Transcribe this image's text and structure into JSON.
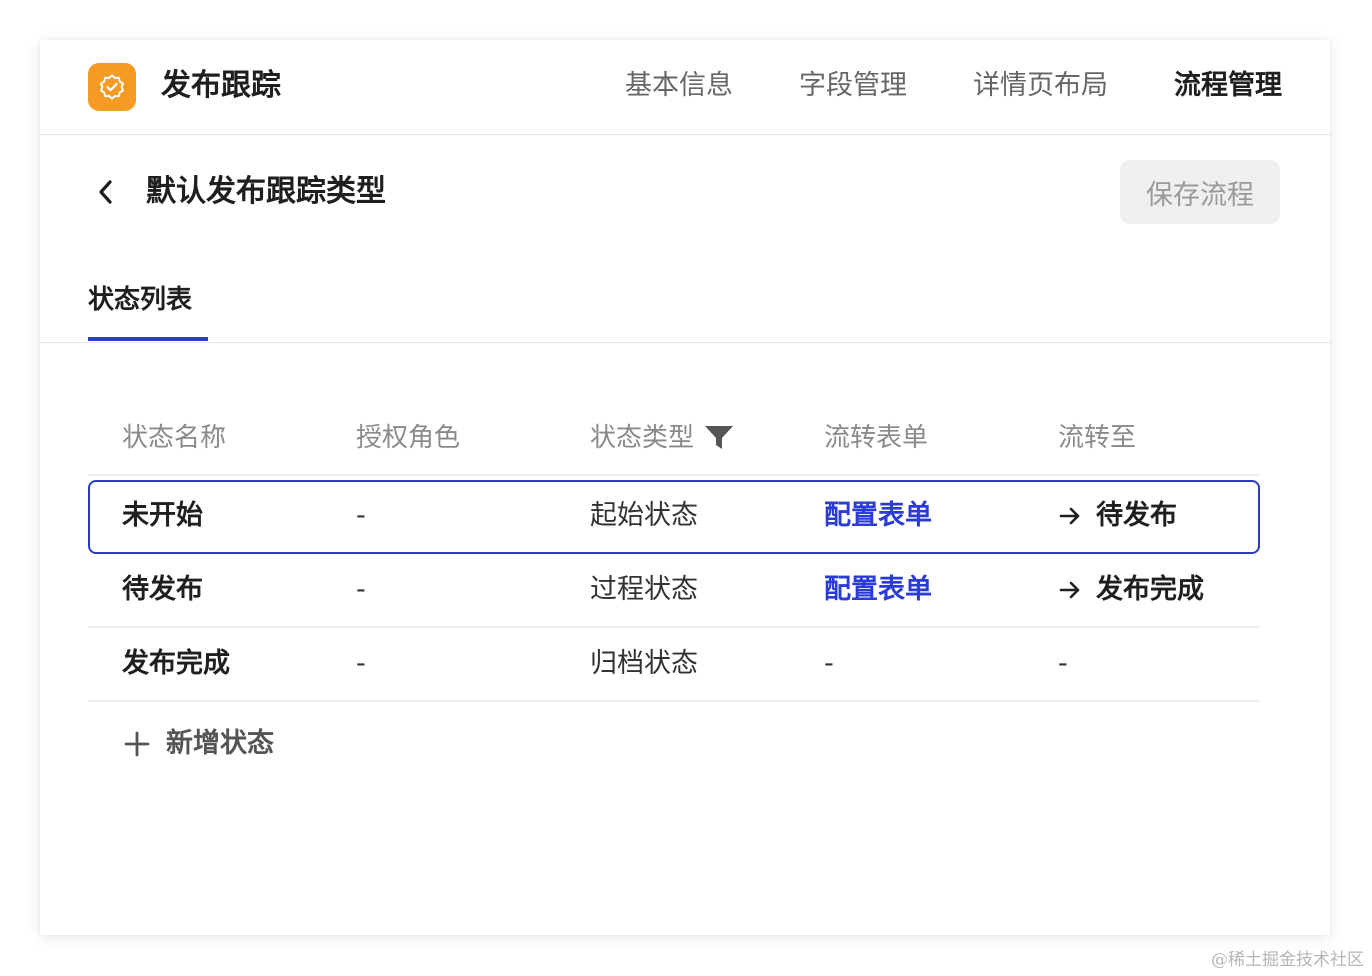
{
  "app": {
    "title": "发布跟踪",
    "logo_icon": "badge-check-icon",
    "logo_color": "#f59a23"
  },
  "top_nav": {
    "items": [
      {
        "label": "基本信息",
        "active": false
      },
      {
        "label": "字段管理",
        "active": false
      },
      {
        "label": "详情页布局",
        "active": false
      },
      {
        "label": "流程管理",
        "active": true
      }
    ]
  },
  "page": {
    "title": "默认发布跟踪类型",
    "back_icon": "chevron-left-icon",
    "save_label": "保存流程"
  },
  "tabs": [
    {
      "label": "状态列表",
      "active": true
    }
  ],
  "table": {
    "columns": [
      "状态名称",
      "授权角色",
      "状态类型",
      "流转表单",
      "流转至"
    ],
    "filter_icon": "filter-icon",
    "rows": [
      {
        "name": "未开始",
        "role": "-",
        "type": "起始状态",
        "form": "配置表单",
        "to": "待发布",
        "selected": true
      },
      {
        "name": "待发布",
        "role": "-",
        "type": "过程状态",
        "form": "配置表单",
        "to": "发布完成",
        "selected": false
      },
      {
        "name": "发布完成",
        "role": "-",
        "type": "归档状态",
        "form": "-",
        "to": "-",
        "selected": false
      }
    ]
  },
  "add_state": {
    "label": "新增状态",
    "icon": "plus-icon"
  },
  "watermark": "@稀土掘金技术社区",
  "colors": {
    "accent": "#2b3bd6",
    "selected_border": "#2a3bbd",
    "link": "#2a3bd6",
    "brand": "#f59a23"
  }
}
